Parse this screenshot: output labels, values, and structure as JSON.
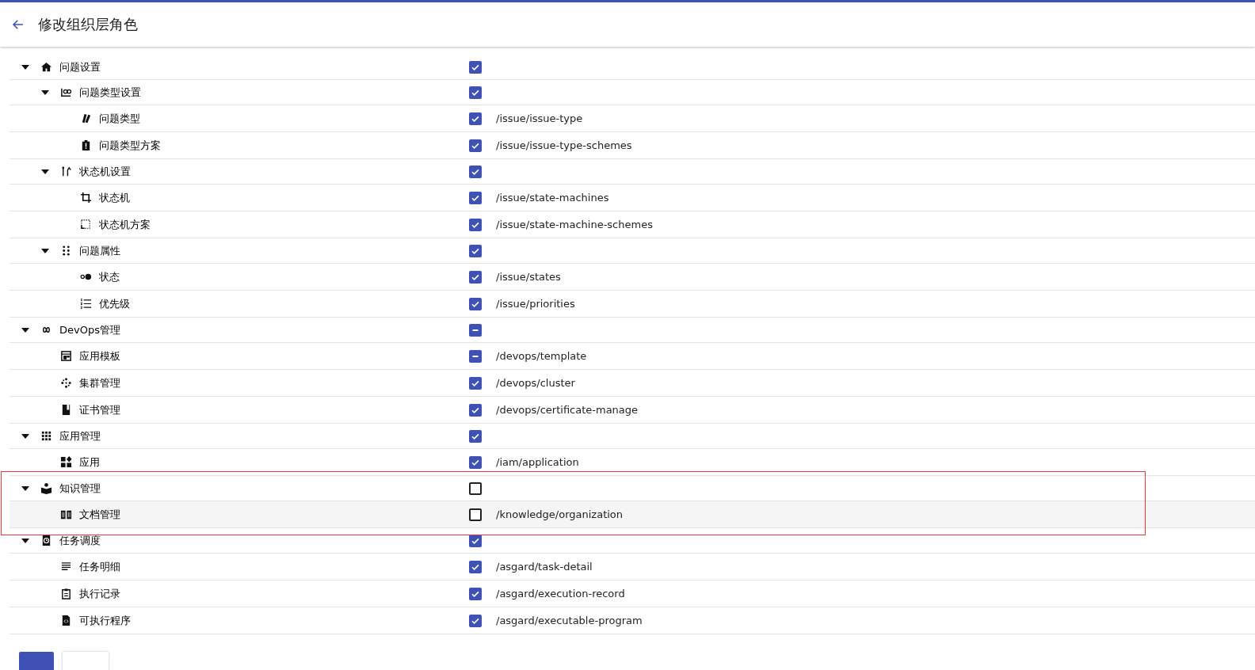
{
  "header": {
    "title": "修改组织层角色"
  },
  "tree": [
    {
      "label": "问题设置",
      "checked": true,
      "expanded": true,
      "highlighted": false,
      "children": [
        {
          "label": "问题类型设置",
          "checked": true,
          "expanded": true,
          "highlighted": false,
          "children": [
            {
              "label": "问题类型",
              "path": "/issue/issue-type",
              "checked": true,
              "highlighted": false
            },
            {
              "label": "问题类型方案",
              "path": "/issue/issue-type-schemes",
              "checked": true,
              "highlighted": false
            }
          ]
        },
        {
          "label": "状态机设置",
          "checked": true,
          "expanded": true,
          "highlighted": false,
          "children": [
            {
              "label": "状态机",
              "path": "/issue/state-machines",
              "checked": true,
              "highlighted": false
            },
            {
              "label": "状态机方案",
              "path": "/issue/state-machine-schemes",
              "checked": true,
              "highlighted": false
            }
          ]
        },
        {
          "label": "问题属性",
          "checked": true,
          "expanded": true,
          "highlighted": false,
          "children": [
            {
              "label": "状态",
              "path": "/issue/states",
              "checked": true,
              "highlighted": false
            },
            {
              "label": "优先级",
              "path": "/issue/priorities",
              "checked": true,
              "highlighted": false
            }
          ]
        }
      ]
    },
    {
      "label": "DevOps管理",
      "indeterminate": true,
      "expanded": true,
      "highlighted": false,
      "children": [
        {
          "label": "应用模板",
          "path": "/devops/template",
          "indeterminate": true,
          "highlighted": false
        },
        {
          "label": "集群管理",
          "path": "/devops/cluster",
          "checked": true,
          "highlighted": false
        },
        {
          "label": "证书管理",
          "path": "/devops/certificate-manage",
          "checked": true,
          "highlighted": false
        }
      ]
    },
    {
      "label": "应用管理",
      "checked": true,
      "expanded": true,
      "highlighted": false,
      "children": [
        {
          "label": "应用",
          "path": "/iam/application",
          "checked": true,
          "highlighted": false
        }
      ]
    },
    {
      "label": "知识管理",
      "checked": false,
      "expanded": true,
      "highlighted": false,
      "children": [
        {
          "label": "文档管理",
          "path": "/knowledge/organization",
          "checked": false,
          "highlighted": true
        }
      ]
    },
    {
      "label": "任务调度",
      "checked": true,
      "expanded": true,
      "highlighted": false,
      "children": [
        {
          "label": "任务明细",
          "path": "/asgard/task-detail",
          "checked": true,
          "highlighted": false
        },
        {
          "label": "执行记录",
          "path": "/asgard/execution-record",
          "checked": true,
          "highlighted": false
        },
        {
          "label": "可执行程序",
          "path": "/asgard/executable-program",
          "checked": true,
          "highlighted": false
        }
      ]
    }
  ]
}
